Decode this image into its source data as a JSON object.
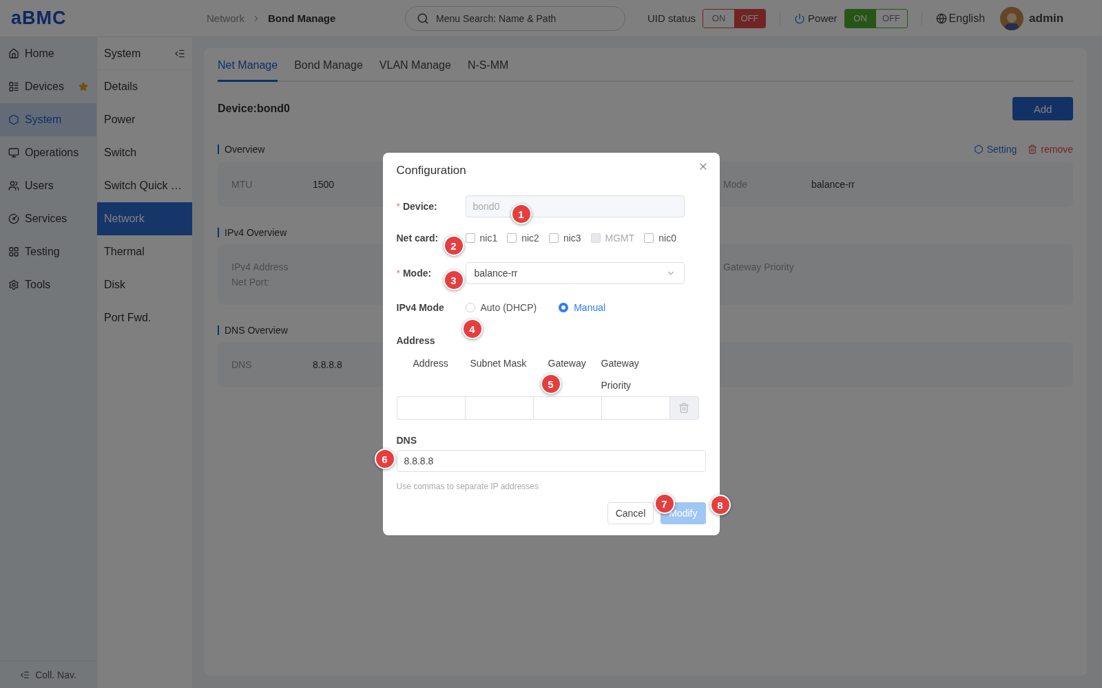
{
  "header": {
    "logo": "aBMC",
    "breadcrumb": [
      {
        "label": "Network",
        "current": false
      },
      {
        "label": "Bond Manage",
        "current": true
      }
    ],
    "search": {
      "placeholder": "Menu Search: Name & Path"
    },
    "toggles": [
      {
        "kind": "uid",
        "label": "UID status",
        "options": [
          {
            "label": "ON",
            "selected": false
          },
          {
            "label": "OFF",
            "selected": true
          }
        ]
      },
      {
        "kind": "power",
        "label": "Power",
        "options": [
          {
            "label": "ON",
            "selected": true
          },
          {
            "label": "OFF",
            "selected": false
          }
        ]
      }
    ],
    "language": "English",
    "user": "admin"
  },
  "nav": {
    "items": [
      {
        "label": "Home",
        "selected": false,
        "starred": false
      },
      {
        "label": "Devices",
        "selected": false,
        "starred": true
      },
      {
        "label": "System",
        "selected": true,
        "starred": false
      },
      {
        "label": "Operations",
        "selected": false,
        "starred": false
      },
      {
        "label": "Users",
        "selected": false,
        "starred": false
      },
      {
        "label": "Services",
        "selected": false,
        "starred": false
      },
      {
        "label": "Testing",
        "selected": false,
        "starred": false
      },
      {
        "label": "Tools",
        "selected": false,
        "starred": false
      }
    ],
    "collapse": "Coll. Nav."
  },
  "subnav": {
    "title": "System",
    "items": [
      {
        "label": "Details",
        "selected": false
      },
      {
        "label": "Power",
        "selected": false
      },
      {
        "label": "Switch",
        "selected": false
      },
      {
        "label": "Switch Quick …",
        "selected": false
      },
      {
        "label": "Network",
        "selected": true
      },
      {
        "label": "Thermal",
        "selected": false
      },
      {
        "label": "Disk",
        "selected": false
      },
      {
        "label": "Port Fwd.",
        "selected": false
      }
    ]
  },
  "tabs": [
    {
      "label": "Net Manage",
      "selected": true
    },
    {
      "label": "Bond Manage",
      "selected": false
    },
    {
      "label": "VLAN Manage",
      "selected": false
    },
    {
      "label": "N-S-MM",
      "selected": false
    }
  ],
  "device_title": "Device:bond0",
  "add_button": "Add",
  "sections": [
    {
      "title": "Overview",
      "actions": [
        {
          "kind": "setting",
          "label": "Setting"
        },
        {
          "kind": "remove",
          "label": "remove"
        }
      ],
      "rows": [
        {
          "left": {
            "label": "MTU",
            "value": "1500"
          },
          "right": {
            "label": "Mode",
            "value": "balance-rr"
          }
        }
      ]
    },
    {
      "title": "IPv4 Overview",
      "rows": [
        {
          "left": {
            "label": "IPv4 Address"
          },
          "right": {
            "label": "Gateway Priority"
          }
        },
        {
          "left": {
            "label": "Net Port:"
          }
        }
      ]
    },
    {
      "title": "DNS Overview",
      "rows": [
        {
          "left": {
            "label": "DNS",
            "value": "8.8.8.8"
          }
        }
      ]
    }
  ],
  "dialog": {
    "title": "Configuration",
    "device": {
      "label": "Device:",
      "required_mark": "*",
      "value": "bond0"
    },
    "net_card": {
      "label": "Net card:",
      "options": [
        {
          "label": "nic1",
          "checked": false,
          "disabled": false
        },
        {
          "label": "nic2",
          "checked": false,
          "disabled": false
        },
        {
          "label": "nic3",
          "checked": false,
          "disabled": false
        },
        {
          "label": "MGMT",
          "checked": false,
          "disabled": true
        },
        {
          "label": "nic0",
          "checked": false,
          "disabled": false
        }
      ]
    },
    "mode": {
      "label": "Mode:",
      "required_mark": "*",
      "value": "balance-rr"
    },
    "ipv4_mode": {
      "label": "IPv4 Mode",
      "options": [
        {
          "label": "Auto (DHCP)",
          "selected": false
        },
        {
          "label": "Manual",
          "selected": true
        }
      ]
    },
    "address": {
      "label": "Address",
      "columns": [
        "Address",
        "Subnet Mask",
        "Gateway",
        "Gateway Priority"
      ]
    },
    "dns": {
      "label": "DNS",
      "value": "8.8.8.8",
      "hint": "Use commas to separate IP addresses"
    },
    "buttons": [
      {
        "kind": "cancel",
        "label": "Cancel",
        "disabled": false
      },
      {
        "kind": "primary",
        "label": "Modify",
        "disabled": true
      }
    ]
  },
  "markers": [
    "1",
    "2",
    "3",
    "4",
    "5",
    "6",
    "7",
    "8"
  ]
}
